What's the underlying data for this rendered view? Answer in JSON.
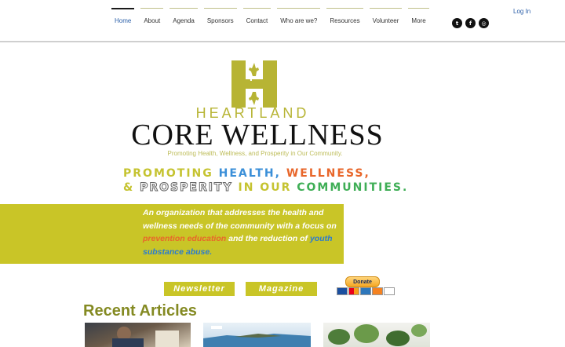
{
  "nav": {
    "items": [
      {
        "label": "Home",
        "active": true
      },
      {
        "label": "About",
        "active": false
      },
      {
        "label": "Agenda",
        "active": false
      },
      {
        "label": "Sponsors",
        "active": false
      },
      {
        "label": "Contact",
        "active": false
      },
      {
        "label": "Who are we?",
        "active": false
      },
      {
        "label": "Resources",
        "active": false
      },
      {
        "label": "Volunteer",
        "active": false
      },
      {
        "label": "More",
        "active": false
      }
    ]
  },
  "social": {
    "twitter": "twitter-icon",
    "facebook": "facebook-icon",
    "instagram": "instagram-icon"
  },
  "auth": {
    "login_label": "Log In"
  },
  "logo": {
    "line1": "HEARTLAND",
    "line2": "CORE WELLNESS",
    "tagline": "Promoting Health, Wellness, and Prosperity in Our Community."
  },
  "headline": {
    "line1": {
      "w1": "PROMOTING",
      "w2": "HEALTH,",
      "w3": "WELLNESS,"
    },
    "line2": {
      "w1": "&",
      "w2": "PROSPERITY",
      "w3": "IN OUR",
      "w4": "COMMUNITIES."
    }
  },
  "mission": {
    "part1": "An organization that addresses the health and wellness needs of the community with a focus on",
    "highlight1": "prevention education",
    "part2": "and the reduction of",
    "highlight2": "youth substance abuse."
  },
  "buttons": {
    "newsletter": "Newsletter",
    "magazine": "Magazine",
    "donate": "Donate"
  },
  "articles": {
    "heading": "Recent Articles"
  },
  "colors": {
    "accent_olive": "#c9c527",
    "brand_text": "#848a22",
    "link_blue": "#2b5fa8"
  }
}
